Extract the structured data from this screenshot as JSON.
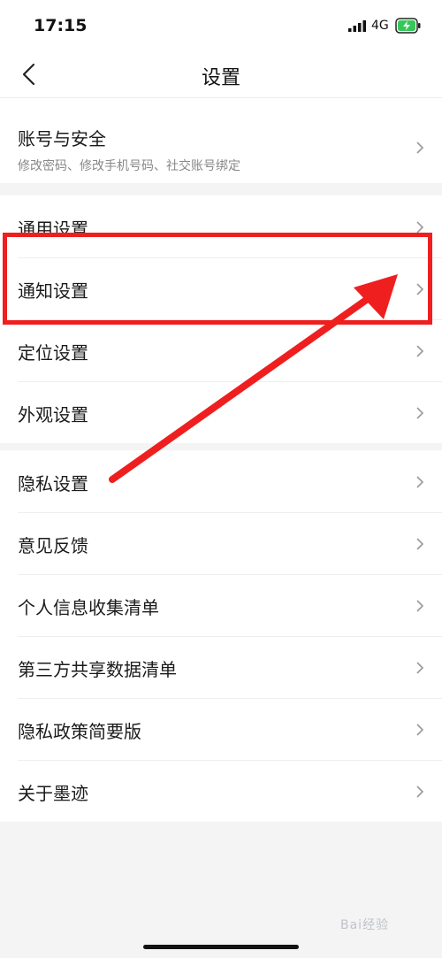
{
  "status_bar": {
    "time": "17:15",
    "network": "4G"
  },
  "nav": {
    "title": "设置"
  },
  "account": {
    "label": "账号与安全",
    "subtitle": "修改密码、修改手机号码、社交账号绑定"
  },
  "group1": [
    "通用设置",
    "通知设置",
    "定位设置",
    "外观设置"
  ],
  "group2": [
    "隐私设置",
    "意见反馈",
    "个人信息收集清单",
    "第三方共享数据清单",
    "隐私政策简要版",
    "关于墨迹"
  ],
  "annotation_color": "#ef1f1f",
  "watermark": "Bai经验"
}
